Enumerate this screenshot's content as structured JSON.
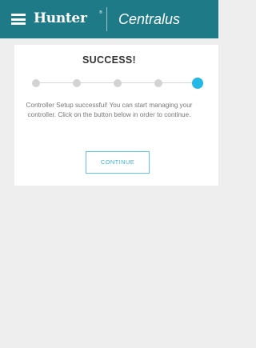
{
  "header": {
    "menu_icon": "hamburger-menu-icon",
    "brand_logo": "Hunter",
    "brand_tm": "®",
    "app_name": "Centralus",
    "background_color": "#1f7a87"
  },
  "card": {
    "title": "SUCCESS!",
    "steps": {
      "total": 5,
      "current": 5,
      "inactive_color": "#d3d3d3",
      "active_color": "#24b8e4"
    },
    "message": "Controller Setup successful! You can start managing your controller. Click on the button below in order to continue.",
    "continue_label": "CONTINUE",
    "accent_color": "#3bb4de"
  }
}
